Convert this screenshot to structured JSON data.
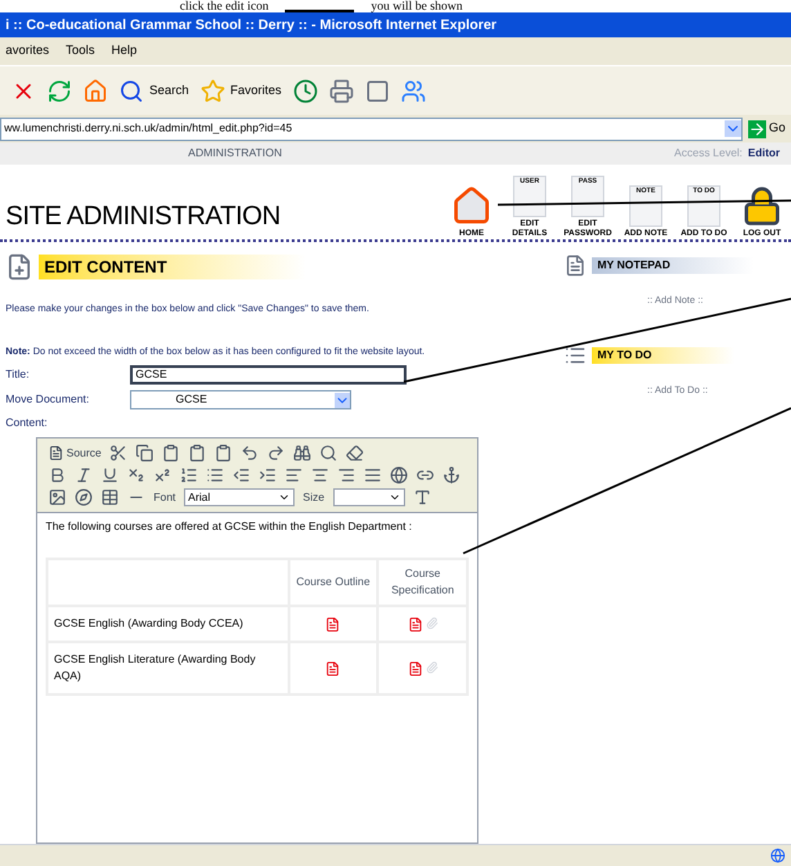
{
  "doc_caption": {
    "before": "click the edit icon",
    "after": "you will be shown"
  },
  "window": {
    "title": "i :: Co-educational Grammar School :: Derry :: - Microsoft Internet Explorer"
  },
  "menu": [
    "avorites",
    "Tools",
    "Help"
  ],
  "toolbar": [
    {
      "kind": "stop"
    },
    {
      "kind": "refresh"
    },
    {
      "kind": "home"
    },
    {
      "kind": "search",
      "label": "Search"
    },
    {
      "kind": "favorites",
      "label": "Favorites"
    },
    {
      "kind": "history"
    },
    {
      "kind": "print"
    },
    {
      "kind": "edit"
    },
    {
      "kind": "messenger"
    }
  ],
  "address": {
    "value": "ww.lumenchristi.derry.ni.sch.uk/admin/html_edit.php?id=45",
    "go": "Go"
  },
  "header": {
    "subtitle": "ADMINISTRATION",
    "access_label": "Access Level:",
    "access_value": "Editor"
  },
  "nav_icons": [
    {
      "kind": "home",
      "label": "HOME"
    },
    {
      "kind": "doc",
      "tag": "USER",
      "label": "EDIT DETAILS"
    },
    {
      "kind": "doc",
      "tag": "PASS",
      "label": "EDIT PASSWORD"
    },
    {
      "kind": "doc",
      "tag": "NOTE",
      "label": "ADD NOTE"
    },
    {
      "kind": "doc",
      "tag": "TO DO",
      "label": "ADD TO DO"
    },
    {
      "kind": "lock",
      "label": "LOG OUT"
    }
  ],
  "page_title": "SITE ADMINISTRATION",
  "section": "EDIT CONTENT",
  "instructions": "Please make your changes in the box below and click \"Save Changes\" to save them.",
  "note": "**Note:** Do not exceed the width of the box below as it has been configured to fit the website layout.",
  "form": {
    "title_label": "Title:",
    "title_value": "GCSE",
    "move_label": "Move Document:",
    "move_value": "GCSE",
    "content_label": "Content:"
  },
  "editor": {
    "source": "Source",
    "font_label": "Font",
    "font_value": "Arial",
    "size_label": "Size",
    "paragraph": "The following courses are offered at GCSE within the English Department :",
    "columns": [
      "Course Outline",
      "Course Specification"
    ],
    "rows": [
      {
        "name": "GCSE English (Awarding Body CCEA)"
      },
      {
        "name": "GCSE English Literature (Awarding Body AQA)"
      }
    ]
  },
  "sidebar": [
    {
      "kind": "notepad",
      "title": "MY NOTEPAD",
      "link": ":: Add Note ::"
    },
    {
      "kind": "todo",
      "title": "MY TO DO",
      "link": ":: Add To Do ::"
    }
  ]
}
